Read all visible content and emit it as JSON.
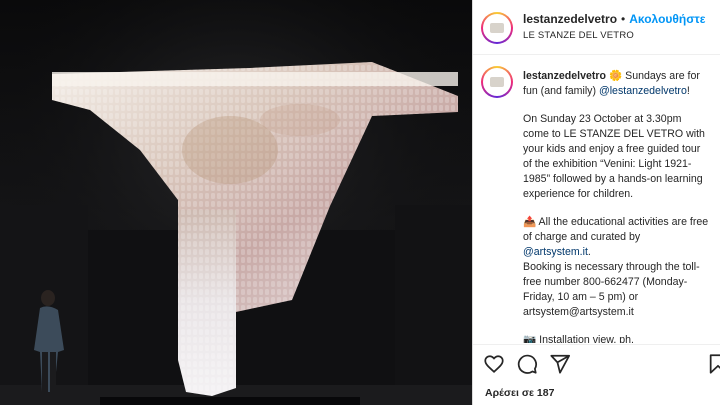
{
  "media": {
    "alt": "Installation view of a cascading glass chandelier sculpture in a dark exhibition hall with a visitor looking up"
  },
  "header": {
    "username": "lestanzedelvetro",
    "separator": "•",
    "follow_label": "Ακολουθήστε",
    "location": "LE STANZE DEL VETRO"
  },
  "caption": {
    "username": "lestanzedelvetro",
    "emoji": "🌼",
    "intro": " Sundays are for fun (and family) ",
    "intro_mention": "@lestanzedelvetro",
    "intro_end": "!",
    "para1": "On Sunday 23 October at 3.30pm come to LE STANZE DEL VETRO with your kids and enjoy a free guided tour of the exhibition “Venini: Light 1921-1985” followed by a hands-on learning experience for children.",
    "para2_icon": "📤",
    "para2_a": " All the educational activities are free of charge and curated by ",
    "para2_mention": "@artsystem.it",
    "para2_b": ".",
    "para2_c": "Booking is necessary through the toll-free number 800-662477 (Monday-Friday, 10 am – 5 pm) or artsystem@artsystem.it",
    "para3_icon": "📷",
    "para3": " Installation view, ph."
  },
  "actions": {
    "likes_text": "Αρέσει σε 187"
  },
  "icons": {
    "like": "heart-icon",
    "comment": "comment-icon",
    "share": "send-icon",
    "save": "bookmark-icon"
  },
  "colors": {
    "follow": "#0095f6",
    "mention": "#00376b",
    "text": "#262626"
  }
}
